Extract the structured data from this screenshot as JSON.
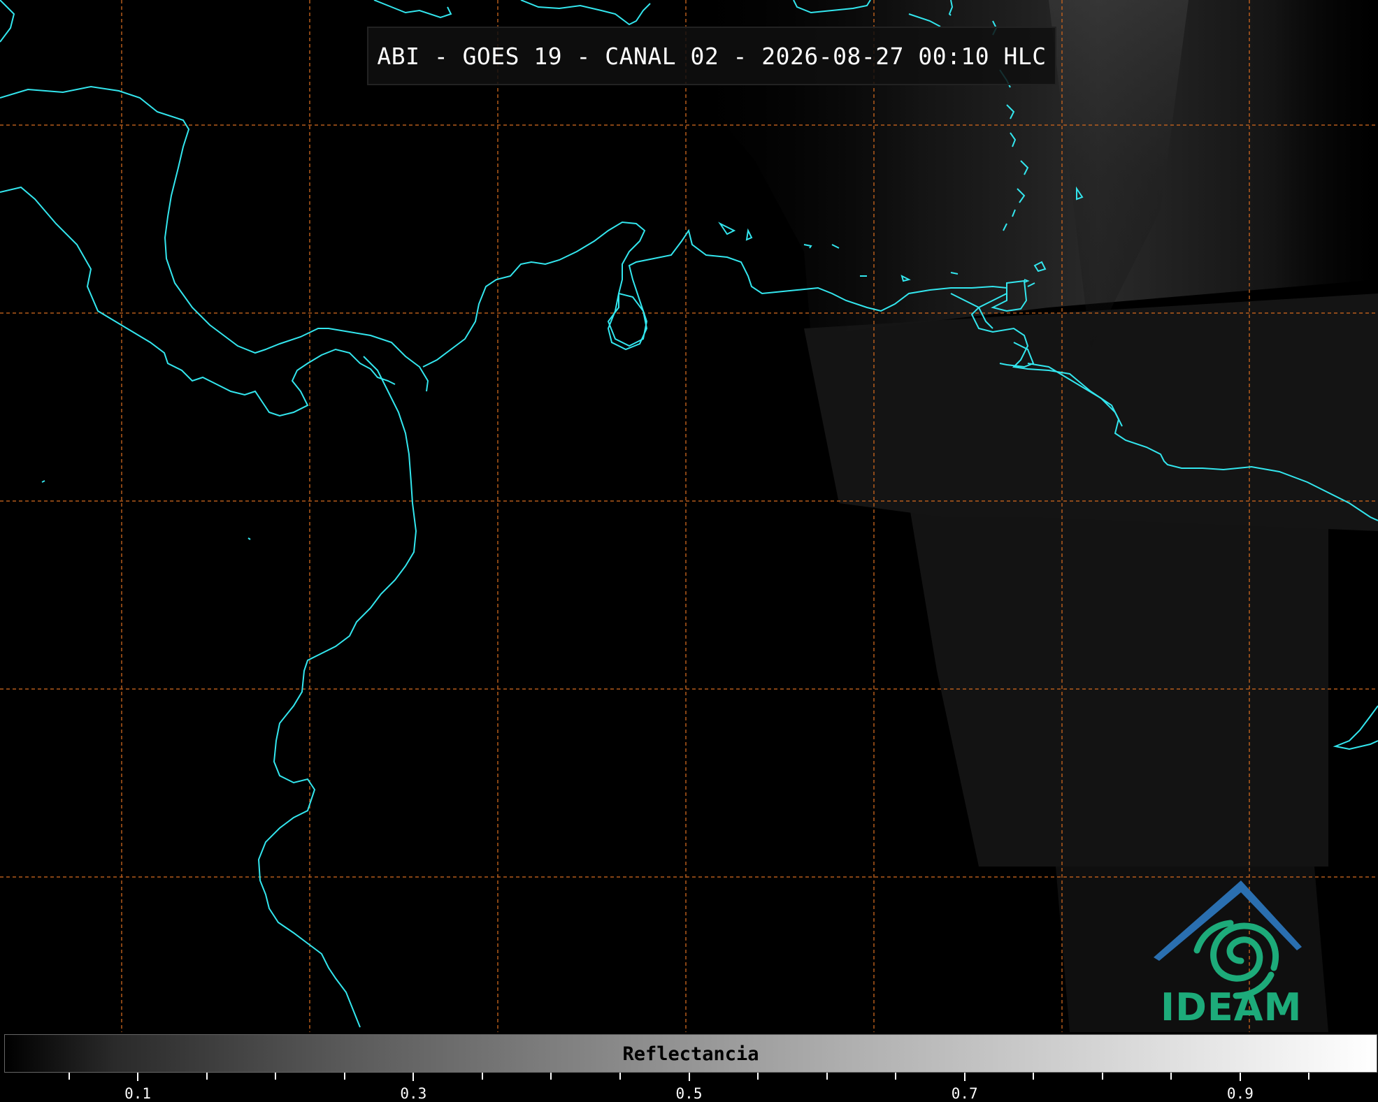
{
  "title": "ABI - GOES 19 - CANAL 02 - 2026-08-27 00:10 HLC",
  "logo": {
    "text": "IDEAM",
    "colors": {
      "roof": "#2a6fb0",
      "swirl": "#1dab7a"
    }
  },
  "colorbar": {
    "label": "Reflectancia",
    "range": [
      0.0,
      1.0
    ],
    "tick_labels": [
      "0.1",
      "0.3",
      "0.5",
      "0.7",
      "0.9"
    ],
    "tick_values": [
      0.1,
      0.3,
      0.5,
      0.7,
      0.9
    ],
    "minor_tick_step": 0.05,
    "colormap": "grayscale (black → white)"
  },
  "map": {
    "coastline_color": "#33e6ee",
    "gridline_color": "#c8641e",
    "gridline_style": "dashed",
    "background": "#000000"
  }
}
